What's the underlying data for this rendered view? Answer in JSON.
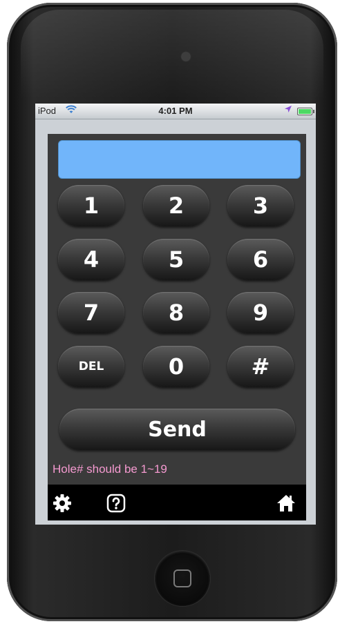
{
  "status_bar": {
    "carrier": "iPod",
    "time": "4:01 PM",
    "battery_level": 1.0
  },
  "display": {
    "value": ""
  },
  "keypad": {
    "rows": [
      [
        "1",
        "2",
        "3"
      ],
      [
        "4",
        "5",
        "6"
      ],
      [
        "7",
        "8",
        "9"
      ],
      [
        "DEL",
        "0",
        "#"
      ]
    ]
  },
  "send_button": {
    "label": "Send"
  },
  "hint": {
    "text": "Hole# should be 1~19"
  },
  "toolbar": {
    "icons": [
      "gear-icon",
      "help-icon",
      "home-icon"
    ]
  },
  "colors": {
    "display_bg": "#71b5fa",
    "app_bg": "#3a3a3a",
    "hint_text": "#f59ad0",
    "toolbar_bg": "#000000"
  }
}
